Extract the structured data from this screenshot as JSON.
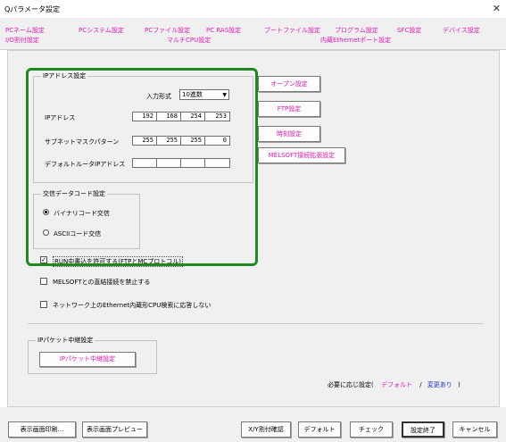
{
  "window": {
    "title": "Qパラメータ設定",
    "close_icon": "close-icon"
  },
  "tabs": {
    "row1": [
      "PCネーム設定",
      "PCシステム設定",
      "PCファイル設定",
      "PC RAS設定",
      "ブートファイル設定",
      "プログラム設定",
      "SFC設定",
      "デバイス設定"
    ],
    "row2": [
      "I/O割付設定",
      "マルチCPU設定",
      "内蔵Ethernetポート設定"
    ]
  },
  "ip_address_group": {
    "title": "IPアドレス設定",
    "input_format_label": "入力形式",
    "input_format_value": "10進数",
    "ip_label": "IPアドレス",
    "ip_values": [
      "192",
      "168",
      "254",
      "253"
    ],
    "subnet_label": "サブネットマスクパターン",
    "subnet_values": [
      "255",
      "255",
      "255",
      "0"
    ],
    "gateway_label": "デフォルトルータIPアドレス",
    "gateway_values": [
      "",
      "",
      "",
      ""
    ]
  },
  "comm_code_group": {
    "title": "交信データコード設定",
    "options": [
      "バイナリコード交信",
      "ASCIIコード交信"
    ],
    "selected": 0
  },
  "right_buttons": [
    "オープン設定",
    "FTP設定",
    "時刻設定",
    "MELSOFT接続拡張設定"
  ],
  "checkboxes": {
    "run_write": {
      "label": "RUN中書込を許可する(FTPとMCプロトコル)",
      "checked": true
    },
    "melsoft_direct": {
      "label": "MELSOFTとの直結接続を禁止する",
      "checked": false
    },
    "no_response": {
      "label": "ネットワーク上のEthernet内蔵形CPU検索に応答しない",
      "checked": false
    }
  },
  "ip_packet_group": {
    "title": "IPパケット中継設定",
    "button": "IPパケット中継設定"
  },
  "footer_note": {
    "prefix": "必要に応じ設定(",
    "default": "デフォルト",
    "slash": "/",
    "changed": "変更あり",
    "suffix": ")"
  },
  "bottom_buttons": {
    "print": "表示画面印刷...",
    "preview": "表示画面プレビュー",
    "xy_check": "X/Y割付確認",
    "default": "デフォルト",
    "check": "チェック",
    "end": "設定終了",
    "cancel": "キャンセル"
  },
  "colors": {
    "accent_pink": "#e01ab7",
    "highlight_green": "#1f8a1f",
    "link_blue": "#1a2fd6"
  }
}
